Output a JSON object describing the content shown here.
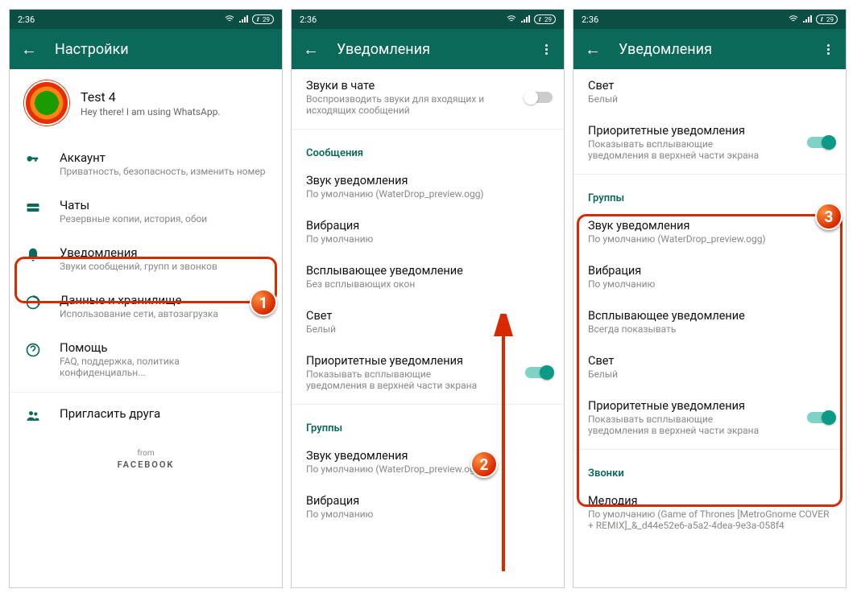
{
  "status": {
    "time": "2:36",
    "battery": "29"
  },
  "screen1": {
    "appbar_title": "Настройки",
    "profile": {
      "name": "Test 4",
      "status": "Hey there! I am using WhatsApp."
    },
    "items": [
      {
        "title": "Аккаунт",
        "sub": "Приватность, безопасность, изменить номер"
      },
      {
        "title": "Чаты",
        "sub": "Резервные копии, история, обои"
      },
      {
        "title": "Уведомления",
        "sub": "Звуки сообщений, групп и звонков"
      },
      {
        "title": "Данные и хранилище",
        "sub": "Использование сети, автозагрузка"
      },
      {
        "title": "Помощь",
        "sub": "FAQ, поддержка, политика конфиденциальн..."
      },
      {
        "title": "Пригласить друга",
        "sub": ""
      }
    ],
    "footer_from": "from",
    "footer_vendor": "FACEBOOK",
    "badge": "1"
  },
  "screen2": {
    "appbar_title": "Уведомления",
    "row_chat_sounds_title": "Звуки в чате",
    "row_chat_sounds_sub": "Воспроизводить звуки для входящих и исходящих сообщений",
    "section_messages": "Сообщения",
    "rows_msg": [
      {
        "title": "Звук уведомления",
        "sub": "По умолчанию (WaterDrop_preview.ogg)"
      },
      {
        "title": "Вибрация",
        "sub": "По умолчанию"
      },
      {
        "title": "Всплывающее уведомление",
        "sub": "Без всплывающих окон"
      },
      {
        "title": "Свет",
        "sub": "Белый"
      },
      {
        "title": "Приоритетные уведомления",
        "sub": "Показывать всплывающие уведомления в верхней части экрана"
      }
    ],
    "section_groups": "Группы",
    "rows_grp": [
      {
        "title": "Звук уведомления",
        "sub": "По умолчанию (WaterDrop_preview.ogg)"
      },
      {
        "title": "Вибрация",
        "sub": "По умолчанию"
      }
    ],
    "badge": "2"
  },
  "screen3": {
    "appbar_title": "Уведомления",
    "row_light_title": "Свет",
    "row_light_sub": "Белый",
    "row_priority_title": "Приоритетные уведомления",
    "row_priority_sub": "Показывать всплывающие уведомления в верхней части экрана",
    "section_groups": "Группы",
    "rows_grp": [
      {
        "title": "Звук уведомления",
        "sub": "По умолчанию (WaterDrop_preview.ogg)"
      },
      {
        "title": "Вибрация",
        "sub": "По умолчанию"
      },
      {
        "title": "Всплывающее уведомление",
        "sub": "Всегда показывать"
      },
      {
        "title": "Свет",
        "sub": "Белый"
      },
      {
        "title": "Приоритетные уведомления",
        "sub": "Показывать всплывающие уведомления в верхней части экрана"
      }
    ],
    "section_calls": "Звонки",
    "row_melody_title": "Мелодия",
    "row_melody_sub": "По умолчанию (Game of Thrones [MetroGnome COVER + REMIX]_&_d44e52e6-a5a2-4dea-9e3a-058f4",
    "badge": "3"
  }
}
